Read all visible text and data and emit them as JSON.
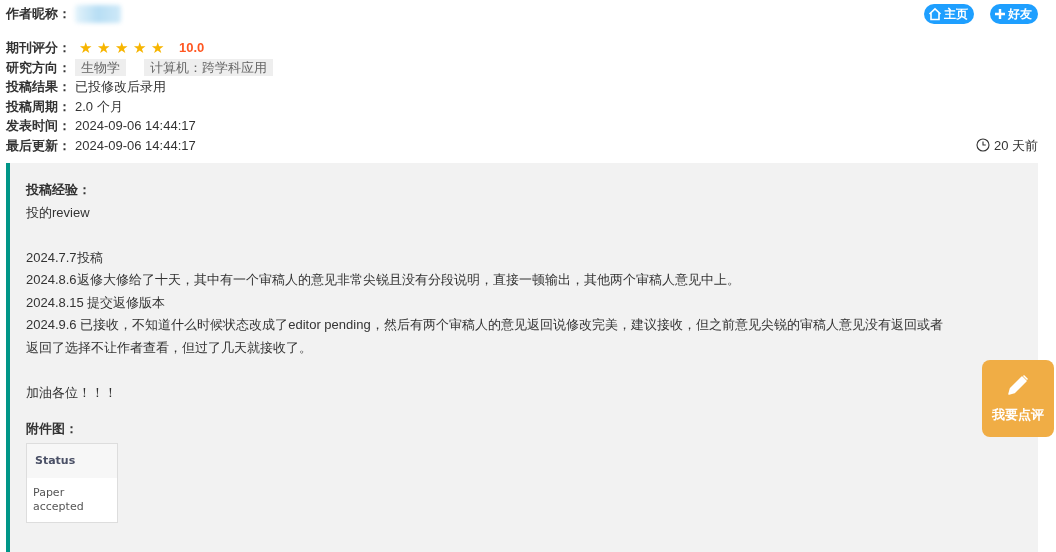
{
  "author": {
    "label": "作者昵称：",
    "name_hidden": true
  },
  "header_buttons": [
    {
      "kind": "home",
      "label": "主页"
    },
    {
      "kind": "add",
      "label": "好友"
    }
  ],
  "fields": [
    {
      "kind": "rating",
      "label": "期刊评分：",
      "stars": 5,
      "score": "10.0"
    },
    {
      "kind": "tags",
      "label": "研究方向：",
      "tags": [
        "生物学",
        "计算机：跨学科应用"
      ]
    },
    {
      "kind": "text",
      "label": "投稿结果：",
      "value": "已投修改后录用"
    },
    {
      "kind": "text",
      "label": "投稿周期：",
      "value": "2.0 个月"
    },
    {
      "kind": "text",
      "label": "发表时间：",
      "value": "2024-09-06 14:44:17"
    },
    {
      "kind": "text",
      "label": "最后更新：",
      "value": "2024-09-06 14:44:17"
    }
  ],
  "time_ago": "20 天前",
  "experience": {
    "title": "投稿经验：",
    "paragraphs": [
      [
        "投的review"
      ],
      [
        "2024.7.7投稿",
        "2024.8.6返修大修给了十天，其中有一个审稿人的意见非常尖锐且没有分段说明，直接一顿输出，其他两个审稿人意见中上。",
        "2024.8.15 提交返修版本",
        "2024.9.6 已接收，不知道什么时候状态改成了editor pending，然后有两个审稿人的意见返回说修改完美，建议接收，但之前意见尖锐的审稿人意见没有返回或者",
        "返回了选择不让作者查看，但过了几天就接收了。"
      ],
      [
        "加油各位！！！"
      ]
    ],
    "attachment_title": "附件图：",
    "attachment": {
      "header": "Status",
      "cell": "Paper accepted"
    }
  },
  "review_button": {
    "label": "我要点评"
  }
}
